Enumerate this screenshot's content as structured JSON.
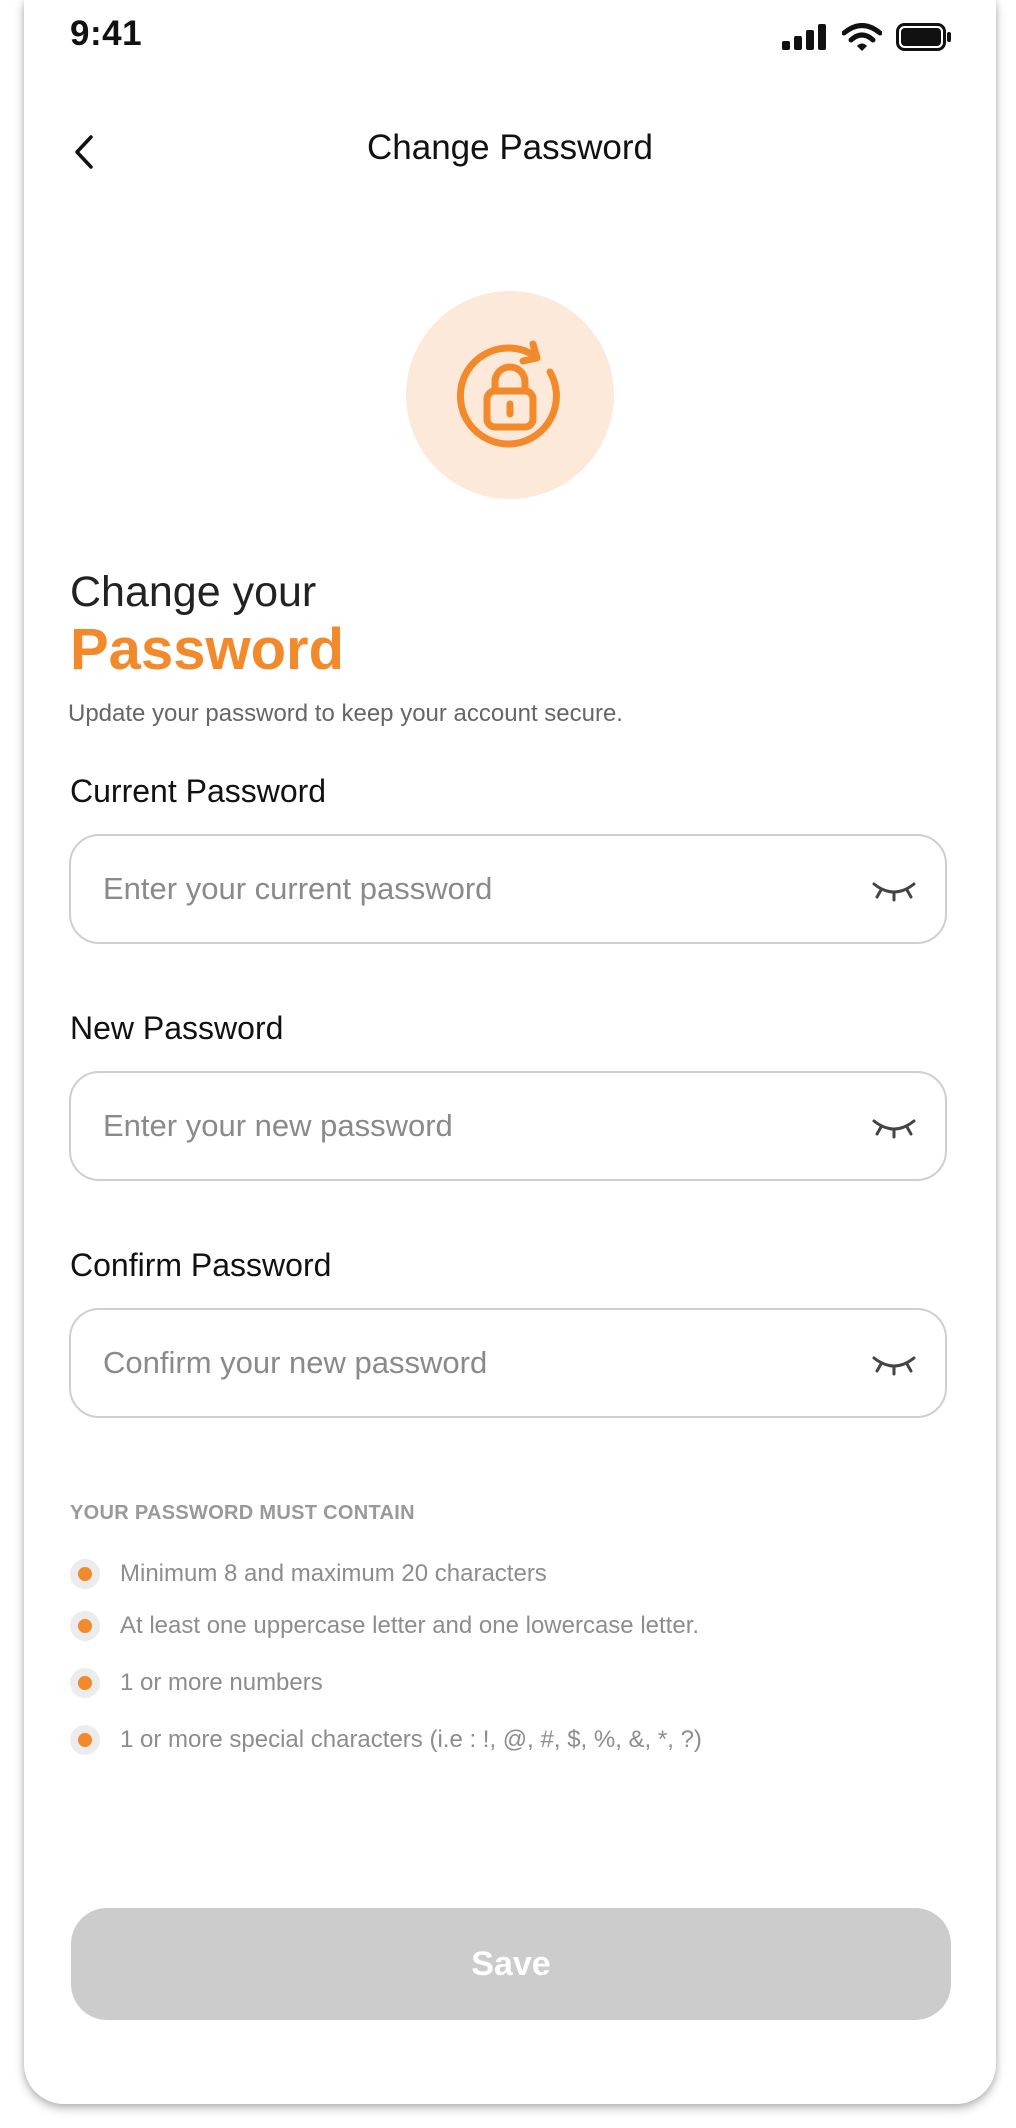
{
  "status_bar": {
    "time": "9:41",
    "icons": [
      "signal-icon",
      "wifi-icon",
      "battery-icon"
    ]
  },
  "nav": {
    "back_icon": "chevron-left-icon",
    "title": "Change Password"
  },
  "illustration": {
    "icon": "lock-refresh-icon",
    "accent_color": "#f28a2c",
    "background_color": "#fde9da"
  },
  "heading": {
    "line1": "Change your",
    "line2": "Password",
    "subtitle": "Update your password to keep your account secure."
  },
  "form": {
    "current": {
      "label": "Current Password",
      "placeholder": "Enter your current password",
      "value": "",
      "toggle_icon": "eye-closed-icon"
    },
    "new": {
      "label": "New Password",
      "placeholder": "Enter your new password",
      "value": "",
      "toggle_icon": "eye-closed-icon"
    },
    "confirm": {
      "label": "Confirm Password",
      "placeholder": "Confirm your new password",
      "value": "",
      "toggle_icon": "eye-closed-icon"
    }
  },
  "requirements": {
    "title": "YOUR PASSWORD MUST CONTAIN",
    "items": [
      "Minimum 8 and maximum 20 characters",
      "At least one uppercase letter and one lowercase letter.",
      "1 or more numbers",
      "1 or more special characters (i.e : !, @, #, $, %, &, *, ?)"
    ]
  },
  "save_button": {
    "label": "Save",
    "color": "#cccccc"
  }
}
